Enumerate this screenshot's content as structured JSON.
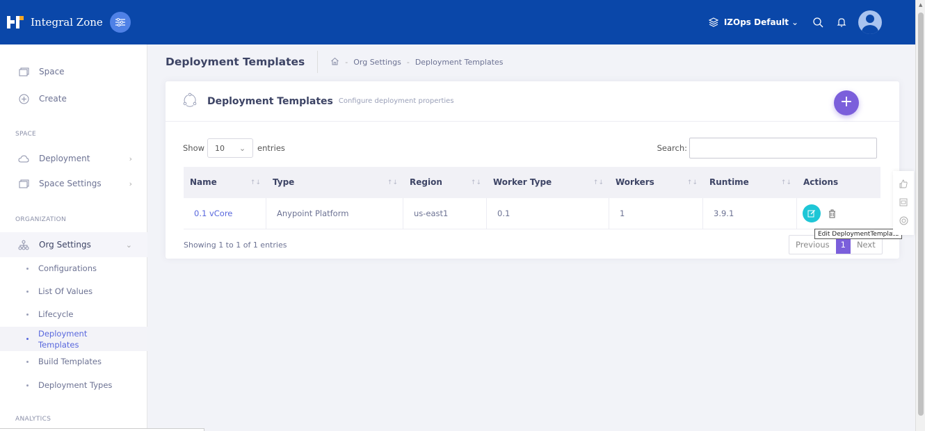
{
  "app": {
    "brand": "Integral Zone"
  },
  "topbar": {
    "org": "IZOps Default"
  },
  "sidebar": {
    "items": [
      {
        "label": "Space"
      },
      {
        "label": "Create"
      }
    ],
    "section_space": "SPACE",
    "space_items": [
      {
        "label": "Deployment"
      },
      {
        "label": "Space Settings"
      }
    ],
    "section_org": "ORGANIZATION",
    "org_settings": "Org Settings",
    "org_sub": [
      {
        "label": "Configurations"
      },
      {
        "label": "List Of Values"
      },
      {
        "label": "Lifecycle"
      },
      {
        "label": "Deployment Templates"
      },
      {
        "label": "Build Templates"
      },
      {
        "label": "Deployment Types"
      }
    ],
    "section_analytics": "ANALYTICS"
  },
  "page": {
    "title": "Deployment Templates",
    "breadcrumb": [
      "Org Settings",
      "Deployment Templates"
    ]
  },
  "card": {
    "title": "Deployment Templates",
    "subtitle": "Configure deployment properties",
    "show_label": "Show",
    "entries_value": "10",
    "entries_label": "entries",
    "search_label": "Search:",
    "search_value": ""
  },
  "table": {
    "columns": [
      "Name",
      "Type",
      "Region",
      "Worker Type",
      "Workers",
      "Runtime",
      "Actions"
    ],
    "rows": [
      {
        "name": "0.1 vCore",
        "type": "Anypoint Platform",
        "region": "us-east1",
        "worker_type": "0.1",
        "workers": "1",
        "runtime": "3.9.1"
      }
    ],
    "info": "Showing 1 to 1 of 1 entries",
    "pager": {
      "previous": "Previous",
      "current": "1",
      "next": "Next"
    }
  },
  "tooltip": "Edit DeploymentTemplate",
  "colors": {
    "topbar": "#0a47a9",
    "accent": "#7b5fdb",
    "link": "#5867dd",
    "edit": "#1ec6d6"
  }
}
